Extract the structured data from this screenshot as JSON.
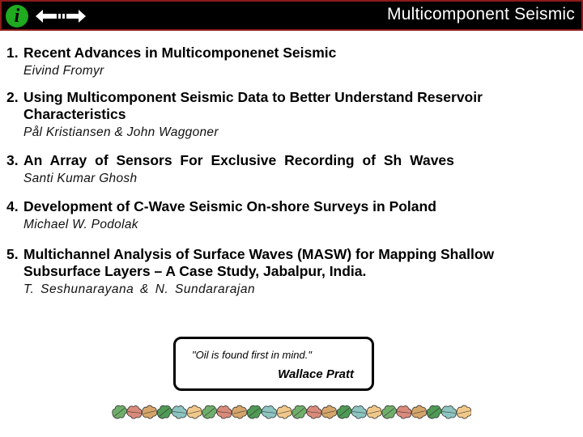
{
  "header": {
    "title": "Multicomponent Seismic",
    "info_icon": "info-icon",
    "nav_icon": "left-right-arrow-icon",
    "info_glyph": "i",
    "colors": {
      "background": "#000000",
      "border": "#8b1a1a",
      "info": "#1faa1f",
      "title": "#ffffff"
    }
  },
  "talks": [
    {
      "number": "1.",
      "title": "Recent Advances in Multicomponenet Seismic",
      "author": "Eivind Fromyr"
    },
    {
      "number": "2.",
      "title": "Using Multicomponent Seismic Data to Better Understand Reservoir Characteristics",
      "author": "Pål Kristiansen & John Waggoner"
    },
    {
      "number": "3.",
      "title": "An Array of Sensors For Exclusive Recording of Sh Waves",
      "author": "Santi Kumar Ghosh"
    },
    {
      "number": "4.",
      "title": "Development of C-Wave Seismic On-shore Surveys in Poland",
      "author": "Michael W. Podolak"
    },
    {
      "number": "5.",
      "title": "Multichannel Analysis of Surface Waves (MASW) for Mapping Shallow Subsurface Layers – A Case Study, Jabalpur, India.",
      "author": "T. Seshunarayana & N. Sundararajan"
    }
  ],
  "quote": {
    "text": "\"Oil is found first in mind.\"",
    "author": "Wallace Pratt"
  },
  "decoration": {
    "icon": "leaf-border-icon",
    "leaf_colors": [
      "#6fae6a",
      "#d98a7a",
      "#d6a56a",
      "#4f9a55",
      "#8cc4c0",
      "#f0c98a"
    ]
  }
}
